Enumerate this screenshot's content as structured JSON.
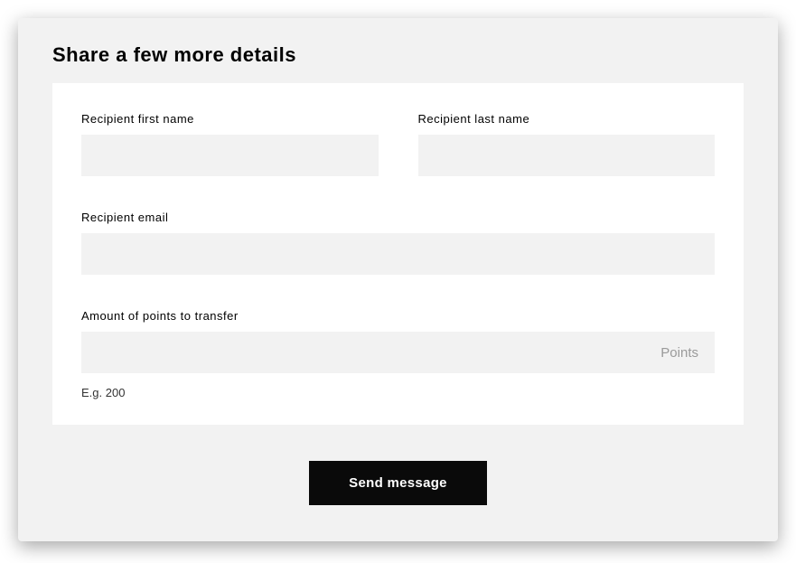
{
  "title": "Share a few more details",
  "form": {
    "first_name": {
      "label": "Recipient first name",
      "value": ""
    },
    "last_name": {
      "label": "Recipient last name",
      "value": ""
    },
    "email": {
      "label": "Recipient email",
      "value": ""
    },
    "points": {
      "label": "Amount of points to transfer",
      "value": "",
      "suffix": "Points",
      "helper": "E.g. 200"
    }
  },
  "button": {
    "send_label": "Send message"
  }
}
